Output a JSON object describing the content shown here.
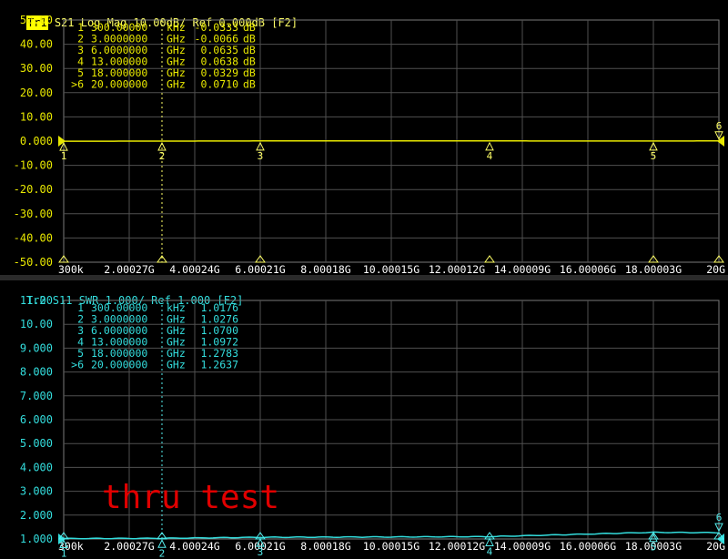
{
  "trace1": {
    "badge": "Tr1",
    "header": " S21 Log Mag 10.00dB/ Ref 0.000dB [F2]",
    "color": "#e8e800",
    "y_ticks": [
      "50.00",
      "40.00",
      "30.00",
      "20.00",
      "10.00",
      "0.000",
      "-10.00",
      "-20.00",
      "-30.00",
      "-40.00",
      "-50.00"
    ],
    "markers": [
      {
        "id": "1",
        "freq": "300.00000",
        "unit": "kHz",
        "value": "-0.0333",
        "vunit": "dB"
      },
      {
        "id": "2",
        "freq": "3.0000000",
        "unit": "GHz",
        "value": "-0.0066",
        "vunit": "dB"
      },
      {
        "id": "3",
        "freq": "6.0000000",
        "unit": "GHz",
        "value": "0.0635",
        "vunit": "dB"
      },
      {
        "id": "4",
        "freq": "13.000000",
        "unit": "GHz",
        "value": "0.0638",
        "vunit": "dB"
      },
      {
        "id": "5",
        "freq": "18.000000",
        "unit": "GHz",
        "value": "0.0329",
        "vunit": "dB"
      },
      {
        "id": ">6",
        "freq": "20.000000",
        "unit": "GHz",
        "value": "0.0710",
        "vunit": "dB"
      }
    ]
  },
  "trace2": {
    "header": "Tr2 S11 SWR 1.000/ Ref 1.000 [F2]",
    "color": "#33dddd",
    "y_ticks": [
      "11.00",
      "10.00",
      "9.000",
      "8.000",
      "7.000",
      "6.000",
      "5.000",
      "4.000",
      "3.000",
      "2.000",
      "1.000"
    ],
    "markers": [
      {
        "id": "1",
        "freq": "300.00000",
        "unit": "kHz",
        "value": "1.0176"
      },
      {
        "id": "2",
        "freq": "3.0000000",
        "unit": "GHz",
        "value": "1.0276"
      },
      {
        "id": "3",
        "freq": "6.0000000",
        "unit": "GHz",
        "value": "1.0700"
      },
      {
        "id": "4",
        "freq": "13.000000",
        "unit": "GHz",
        "value": "1.0972"
      },
      {
        "id": "5",
        "freq": "18.000000",
        "unit": "GHz",
        "value": "1.2783"
      },
      {
        "id": ">6",
        "freq": "20.000000",
        "unit": "GHz",
        "value": "1.2637"
      }
    ]
  },
  "x_ticks": [
    "300k",
    "2.00027G",
    "4.00024G",
    "6.00021G",
    "8.00018G",
    "10.00015G",
    "12.00012G",
    "14.00009G",
    "16.00006G",
    "18.00003G",
    "20G"
  ],
  "annotation": "thru test",
  "chart_data": [
    {
      "type": "line",
      "ylim": [
        -50,
        50
      ],
      "xlim_ghz": [
        0.0003,
        20
      ],
      "series": [
        {
          "x_ghz": [
            0.0003,
            3,
            6,
            13,
            18,
            20
          ],
          "y": [
            -0.0333,
            -0.0066,
            0.0635,
            0.0638,
            0.0329,
            0.071
          ]
        }
      ]
    },
    {
      "type": "line",
      "ylim": [
        1,
        11
      ],
      "xlim_ghz": [
        0.0003,
        20
      ],
      "series": [
        {
          "x_ghz": [
            0.0003,
            3,
            6,
            13,
            18,
            20
          ],
          "y": [
            1.0176,
            1.0276,
            1.07,
            1.0972,
            1.2783,
            1.2637
          ]
        }
      ]
    }
  ]
}
